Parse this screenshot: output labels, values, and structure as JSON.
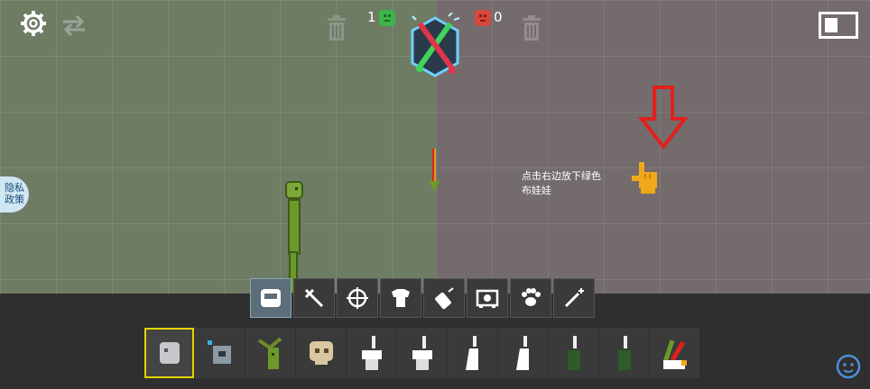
{
  "teams": {
    "green": {
      "count": "1",
      "color": "#3db54a"
    },
    "red": {
      "count": "0",
      "color": "#d9483b"
    }
  },
  "privacy": {
    "line1": "隐私",
    "line2": "政策"
  },
  "hint": {
    "line1": "点击右边放下绿色",
    "line2": "布娃娃"
  },
  "categories": [
    {
      "name": "entities",
      "active": true
    },
    {
      "name": "melee"
    },
    {
      "name": "firearms"
    },
    {
      "name": "clothing"
    },
    {
      "name": "explosives"
    },
    {
      "name": "machinery"
    },
    {
      "name": "animals"
    },
    {
      "name": "powers"
    }
  ],
  "items": [
    "gray-block-figure",
    "robot-head",
    "green-plant-creature",
    "bone-skull",
    "white-toilet",
    "white-toilet-2",
    "white-figure",
    "white-figure-2",
    "green-figure",
    "green-figure-2",
    "colorful-creature"
  ],
  "colors": {
    "accent_yellow": "#e4d400",
    "arrow_red": "#e0201b",
    "melon_green": "#6b9a2a"
  }
}
